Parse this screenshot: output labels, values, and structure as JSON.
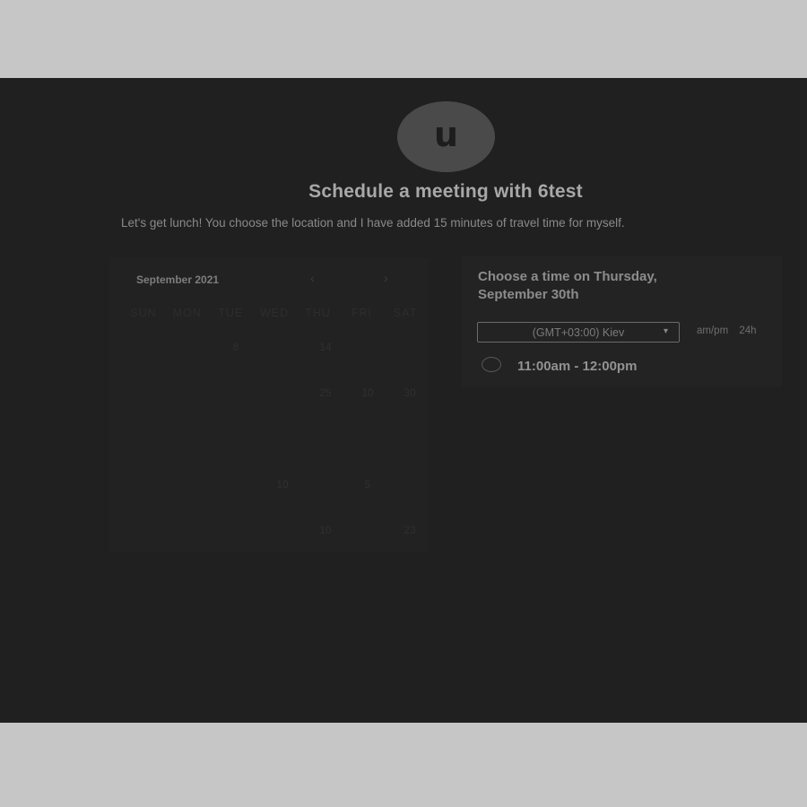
{
  "profile": {
    "avatar_letter": "u"
  },
  "header": {
    "title": "Schedule a meeting with 6test",
    "subtitle": "Let's get lunch! You choose the location and I have added 15 minutes of travel time for myself."
  },
  "calendar": {
    "month_label": "September 2021",
    "prev_icon": "chevron-left-icon",
    "next_icon": "chevron-right-icon",
    "weekdays": [
      "SUN",
      "MON",
      "TUE",
      "WED",
      "THU",
      "FRI",
      "SAT"
    ],
    "visible_days": [
      {
        "label": "8"
      },
      {
        "label": "14"
      },
      {
        "label": "25"
      },
      {
        "label": "10"
      },
      {
        "label": "30"
      },
      {
        "label": "10"
      },
      {
        "label": "5"
      },
      {
        "label": "10"
      },
      {
        "label": "23"
      }
    ]
  },
  "times": {
    "heading_line1": "Choose a time on Thursday,",
    "heading_line2": "September 30th",
    "timezone": "(GMT+03:00) Kiev",
    "format_ampm": "am/pm",
    "format_24h": "24h",
    "slots": [
      {
        "label": "11:00am - 12:00pm"
      }
    ]
  },
  "colors": {
    "backdrop": "#c6c6c6",
    "panel": "#202020",
    "avatar": "#4a4a4a"
  }
}
